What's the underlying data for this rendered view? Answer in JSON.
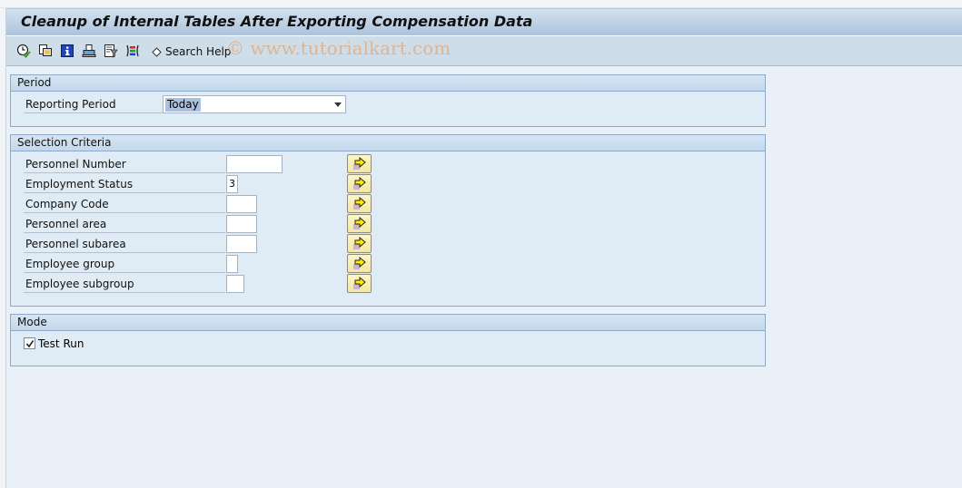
{
  "window": {
    "title": "Cleanup of Internal Tables After Exporting Compensation Data"
  },
  "toolbar": {
    "icons": [
      {
        "name": "execute-icon",
        "tooltip": "Execute"
      },
      {
        "name": "get-variant-icon",
        "tooltip": "Get Variant"
      },
      {
        "name": "program-info-icon",
        "tooltip": "Program Documentation"
      },
      {
        "name": "print-icon",
        "tooltip": "Print"
      },
      {
        "name": "selection-options-icon",
        "tooltip": "Selection Options"
      },
      {
        "name": "multiple-selection-icon",
        "tooltip": "Multiple Selection"
      }
    ],
    "search_help_label": "Search Help",
    "watermark": "© www.tutorialkart.com"
  },
  "period": {
    "header": "Period",
    "reporting_period_label": "Reporting Period",
    "reporting_period_value": "Today"
  },
  "selection": {
    "header": "Selection Criteria",
    "fields": [
      {
        "label": "Personnel Number",
        "value": ""
      },
      {
        "label": "Employment Status",
        "value": "3"
      },
      {
        "label": "Company Code",
        "value": ""
      },
      {
        "label": "Personnel area",
        "value": ""
      },
      {
        "label": "Personnel subarea",
        "value": ""
      },
      {
        "label": "Employee group",
        "value": ""
      },
      {
        "label": "Employee subgroup",
        "value": ""
      }
    ]
  },
  "mode": {
    "header": "Mode",
    "test_run_label": "Test Run",
    "test_run_checked": true
  },
  "colors": {
    "background": "#e9f0f8",
    "group_border": "#8fa9c6",
    "title_gradient_top": "#d2e1ee",
    "title_gradient_bottom": "#adc4dc",
    "toolbar": "#cfdde8",
    "multisel_button": "#f4e7a0"
  }
}
